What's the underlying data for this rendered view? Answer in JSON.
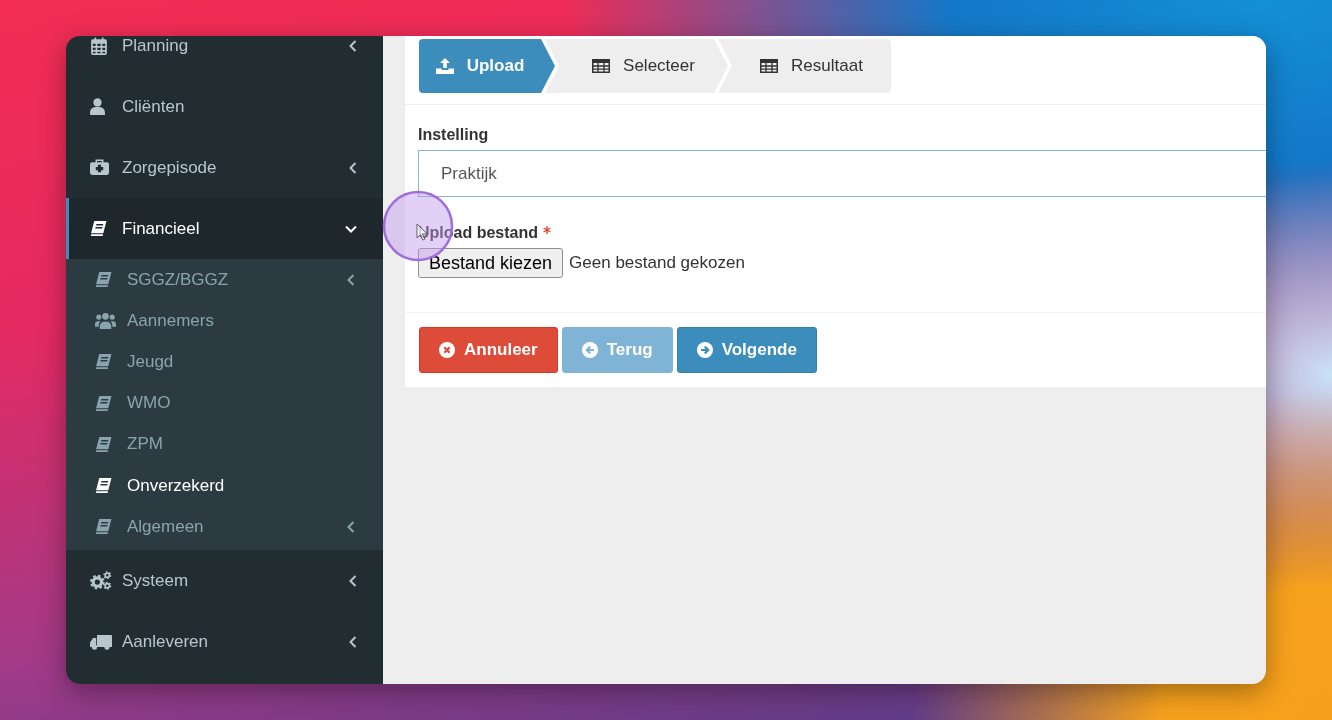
{
  "sidebar": {
    "items": [
      {
        "label": "Planning",
        "kind": "menu",
        "expanded": false,
        "selected": false
      },
      {
        "label": "Cliënten",
        "kind": "link",
        "selected": false
      },
      {
        "label": "Zorgepisode",
        "kind": "menu",
        "expanded": false,
        "selected": false
      },
      {
        "label": "Financieel",
        "kind": "menu",
        "expanded": true,
        "selected": true,
        "children": [
          {
            "label": "SGGZ/BGGZ",
            "kind": "menu",
            "expanded": false,
            "selected": false
          },
          {
            "label": "Aannemers",
            "kind": "link",
            "selected": false
          },
          {
            "label": "Jeugd",
            "kind": "link",
            "selected": false
          },
          {
            "label": "WMO",
            "kind": "link",
            "selected": false
          },
          {
            "label": "ZPM",
            "kind": "link",
            "selected": false
          },
          {
            "label": "Onverzekerd",
            "kind": "link",
            "selected": true
          },
          {
            "label": "Algemeen",
            "kind": "menu",
            "expanded": false,
            "selected": false
          }
        ]
      },
      {
        "label": "Systeem",
        "kind": "menu",
        "expanded": false,
        "selected": false
      },
      {
        "label": "Aanleveren",
        "kind": "menu",
        "expanded": false,
        "selected": false
      }
    ]
  },
  "steps": [
    {
      "label": "Upload",
      "selected": true
    },
    {
      "label": "Selecteer",
      "selected": false
    },
    {
      "label": "Resultaat",
      "selected": false
    }
  ],
  "form": {
    "instelling": {
      "label": "Instelling",
      "value": "Praktijk"
    },
    "upload": {
      "label": "Upload bestand",
      "required": true,
      "button": "Bestand kiezen",
      "status": "Geen bestand gekozen"
    }
  },
  "actions": [
    {
      "label": "Annuleer",
      "kind": "cancel",
      "disabled": false
    },
    {
      "label": "Terug",
      "kind": "back",
      "disabled": true
    },
    {
      "label": "Volgende",
      "kind": "next",
      "disabled": false
    }
  ]
}
